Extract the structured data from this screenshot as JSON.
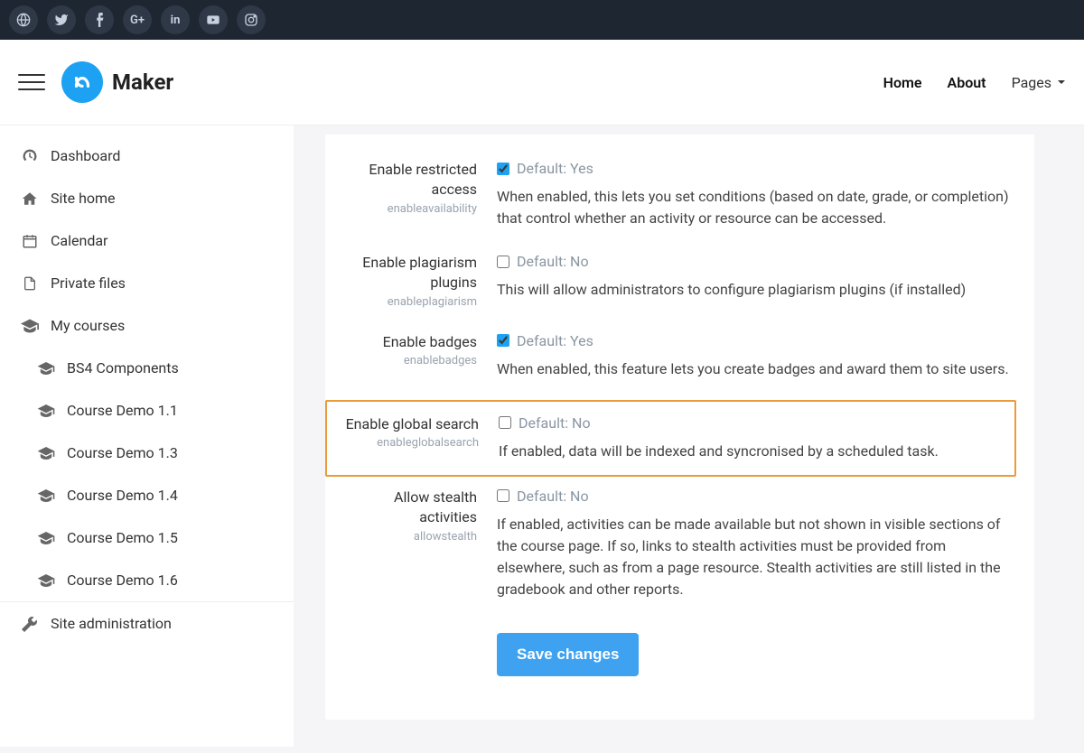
{
  "brand": "Maker",
  "nav": {
    "home": "Home",
    "about": "About",
    "pages": "Pages"
  },
  "sidebar": {
    "dashboard": "Dashboard",
    "sitehome": "Site home",
    "calendar": "Calendar",
    "privatefiles": "Private files",
    "mycourses": "My courses",
    "courses": [
      "BS4 Components",
      "Course Demo 1.1",
      "Course Demo 1.3",
      "Course Demo 1.4",
      "Course Demo 1.5",
      "Course Demo 1.6"
    ],
    "siteadmin": "Site administration"
  },
  "settings": [
    {
      "title": "Enable restricted access",
      "key": "enableavailability",
      "checked": true,
      "default": "Default: Yes",
      "help": "When enabled, this lets you set conditions (based on date, grade, or completion) that control whether an activity or resource can be accessed.",
      "highlight": false
    },
    {
      "title": "Enable plagiarism plugins",
      "key": "enableplagiarism",
      "checked": false,
      "default": "Default: No",
      "help": "This will allow administrators to configure plagiarism plugins (if installed)",
      "highlight": false
    },
    {
      "title": "Enable badges",
      "key": "enablebadges",
      "checked": true,
      "default": "Default: Yes",
      "help": "When enabled, this feature lets you create badges and award them to site users.",
      "highlight": false
    },
    {
      "title": "Enable global search",
      "key": "enableglobalsearch",
      "checked": false,
      "default": "Default: No",
      "help": "If enabled, data will be indexed and syncronised by a scheduled task.",
      "highlight": true
    },
    {
      "title": "Allow stealth activities",
      "key": "allowstealth",
      "checked": false,
      "default": "Default: No",
      "help": "If enabled, activities can be made available but not shown in visible sections of the course page. If so, links to stealth activities must be provided from elsewhere, such as from a page resource. Stealth activities are still listed in the gradebook and other reports.",
      "highlight": false
    }
  ],
  "save_label": "Save changes"
}
